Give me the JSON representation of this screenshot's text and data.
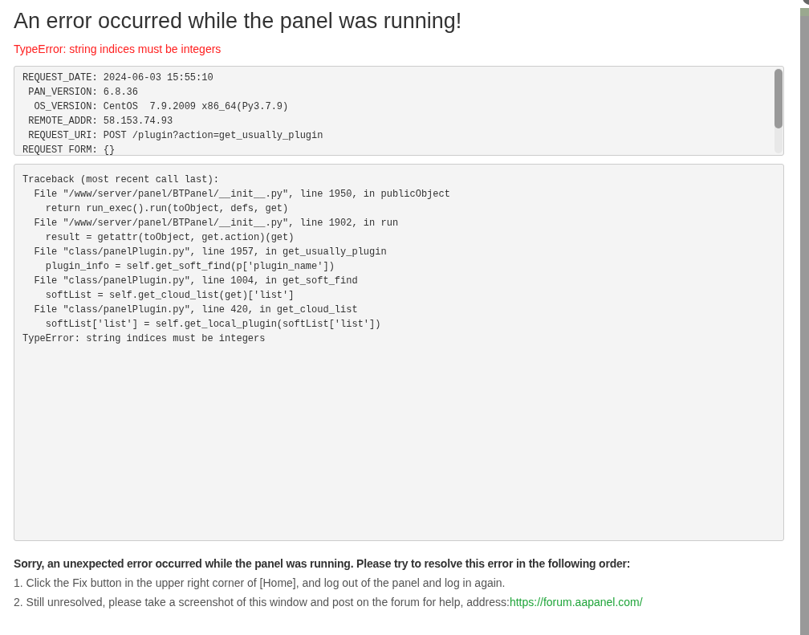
{
  "title": "An error occurred while the panel was running!",
  "error_message": "TypeError: string indices must be integers",
  "request_info": {
    "lines": [
      "REQUEST_DATE: 2024-06-03 15:55:10",
      " PAN_VERSION: 6.8.36",
      "  OS_VERSION: CentOS  7.9.2009 x86_64(Py3.7.9)",
      " REMOTE_ADDR: 58.153.74.93",
      " REQUEST_URI: POST /plugin?action=get_usually_plugin",
      "REQUEST FORM: {}"
    ]
  },
  "traceback": {
    "lines": [
      "Traceback (most recent call last):",
      "  File \"/www/server/panel/BTPanel/__init__.py\", line 1950, in publicObject",
      "    return run_exec().run(toObject, defs, get)",
      "  File \"/www/server/panel/BTPanel/__init__.py\", line 1902, in run",
      "    result = getattr(toObject, get.action)(get)",
      "  File \"class/panelPlugin.py\", line 1957, in get_usually_plugin",
      "    plugin_info = self.get_soft_find(p['plugin_name'])",
      "  File \"class/panelPlugin.py\", line 1004, in get_soft_find",
      "    softList = self.get_cloud_list(get)['list']",
      "  File \"class/panelPlugin.py\", line 420, in get_cloud_list",
      "    softList['list'] = self.get_local_plugin(softList['list'])",
      "TypeError: string indices must be integers"
    ]
  },
  "help": {
    "heading": "Sorry, an unexpected error occurred while the panel was running. Please try to resolve this error in the following order:",
    "steps": [
      {
        "text": "1. Click the Fix button in the upper right corner of [Home], and log out of the panel and log in again."
      },
      {
        "text": "2. Still unresolved, please take a screenshot of this window and post on the forum for help, address:",
        "link": "https://forum.aapanel.com/"
      }
    ]
  }
}
